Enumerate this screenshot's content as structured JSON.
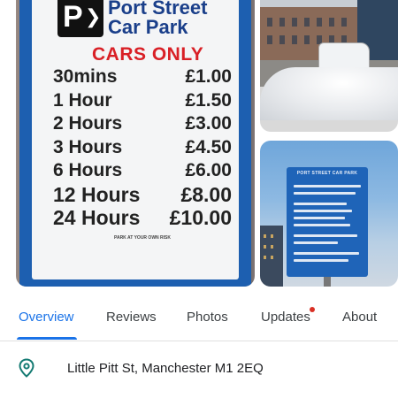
{
  "gallery": {
    "main_photo": {
      "sign_title_line1": "Port Street",
      "sign_title_line2": "Car Park",
      "sign_subtitle": "CARS ONLY",
      "rates": [
        {
          "duration": "30mins",
          "price": "£1.00"
        },
        {
          "duration": "1 Hour",
          "price": "£1.50"
        },
        {
          "duration": "2 Hours",
          "price": "£3.00"
        },
        {
          "duration": "3 Hours",
          "price": "£4.50"
        },
        {
          "duration": "6 Hours",
          "price": "£6.00"
        },
        {
          "duration": "12 Hours",
          "price": "£8.00"
        },
        {
          "duration": "24 Hours",
          "price": "£10.00"
        }
      ],
      "fine_print_heading": "PARK AT YOUR OWN RISK"
    },
    "side_bottom_photo": {
      "mini_sign_title": "PORT STREET CAR PARK"
    }
  },
  "tabs": {
    "items": [
      {
        "label": "Overview",
        "active": true
      },
      {
        "label": "Reviews",
        "active": false
      },
      {
        "label": "Photos",
        "active": false
      },
      {
        "label": "Updates",
        "active": false,
        "has_notification_dot": true
      },
      {
        "label": "About",
        "active": false
      }
    ]
  },
  "address": {
    "icon": "location-pin-icon",
    "text": "Little Pitt St, Manchester M1 2EQ"
  },
  "colors": {
    "accent": "#1a73e8",
    "notification_dot": "#d93025",
    "pin_icon": "#137a72"
  }
}
